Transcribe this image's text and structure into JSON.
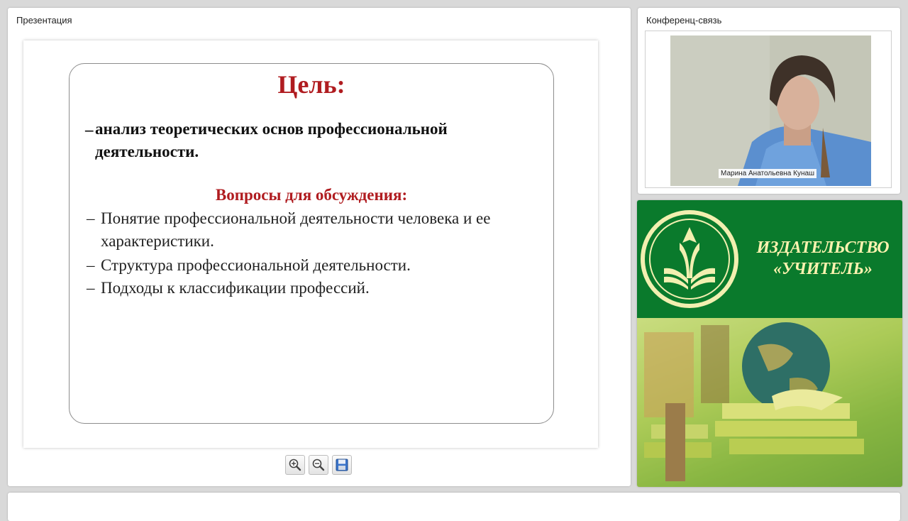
{
  "presentation": {
    "panel_title": "Презентация",
    "slide": {
      "title": "Цель:",
      "goal_dash": "–",
      "goal_text": "анализ теоретических основ профессиональной деятельности.",
      "questions_heading": "Вопросы для обсуждения:",
      "items": [
        {
          "dash": "–",
          "text": "Понятие профессиональной деятельности человека и ее характеристики."
        },
        {
          "dash": "–",
          "text": "Структура профессиональной деятельности."
        },
        {
          "dash": "–",
          "text": "Подходы к классификации профессий."
        }
      ]
    },
    "toolbar": [
      "zoom-in-icon",
      "zoom-out-icon",
      "save-icon"
    ]
  },
  "conference": {
    "panel_title": "Конференц-связь",
    "participant_name": "Марина Анатольевна Кунаш"
  },
  "publisher": {
    "line1": "ИЗДАТЕЛЬСТВО",
    "line2": "«УЧИТЕЛЬ»",
    "logo_color": "#f2efb0",
    "bg_color": "#0a7a2c"
  }
}
